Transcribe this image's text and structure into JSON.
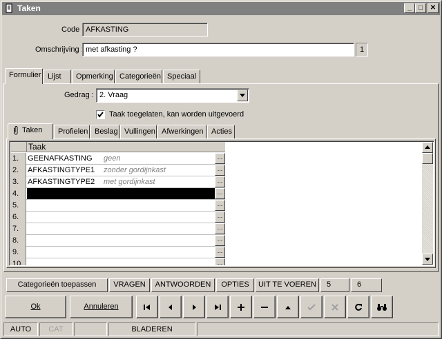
{
  "window": {
    "title": "Taken",
    "icon": "document-icon",
    "minimize": "_",
    "maximize": "□",
    "close": "✕"
  },
  "form": {
    "code_label": "Code :",
    "code_value": "AFKASTING",
    "omschrijving_label": "Omschrijving :",
    "omschrijving_value": "met afkasting ?",
    "omschrijving_count": "1"
  },
  "main_tabs": [
    "Formulier",
    "Lijst",
    "Opmerking",
    "Categorieën",
    "Speciaal"
  ],
  "formulier": {
    "gedrag_label": "Gedrag :",
    "gedrag_value": "2.  Vraag",
    "checkbox_label": "Taak toegelaten, kan worden uitgevoerd",
    "checkbox_checked": true
  },
  "sub_tabs": [
    "Taken",
    "Profielen",
    "Beslag",
    "Vullingen",
    "Afwerkingen",
    "Acties"
  ],
  "grid": {
    "column_header": "Taak",
    "ellipsis": "...",
    "rows": [
      {
        "num": "1.",
        "value": "GEENAFKASTING",
        "desc": "geen"
      },
      {
        "num": "2.",
        "value": "AFKASTINGTYPE1",
        "desc": "zonder gordijnkast"
      },
      {
        "num": "3.",
        "value": "AFKASTINGTYPE2",
        "desc": "met gordijnkast"
      },
      {
        "num": "4.",
        "value": "",
        "desc": ""
      },
      {
        "num": "5.",
        "value": "",
        "desc": ""
      },
      {
        "num": "6.",
        "value": "",
        "desc": ""
      },
      {
        "num": "7.",
        "value": "",
        "desc": ""
      },
      {
        "num": "8.",
        "value": "",
        "desc": ""
      },
      {
        "num": "9.",
        "value": "",
        "desc": ""
      },
      {
        "num": "10.",
        "value": "",
        "desc": ""
      }
    ],
    "selected_row": 4
  },
  "panel_buttons": [
    "Categorieën toepassen",
    "VRAGEN",
    "ANTWOORDEN",
    "OPTIES",
    "UIT TE VOEREN",
    "5",
    "6"
  ],
  "action_buttons": {
    "ok": "Ok",
    "annuleren": "Annuleren"
  },
  "nav_icons": [
    "first-record-icon",
    "previous-record-icon",
    "next-record-icon",
    "last-record-icon",
    "add-icon",
    "delete-icon",
    "up-icon",
    "confirm-icon",
    "cancel-icon",
    "refresh-icon",
    "search-binoculars-icon"
  ],
  "status_bar": [
    "AUTO",
    "CAT",
    "",
    "BLADEREN",
    ""
  ]
}
